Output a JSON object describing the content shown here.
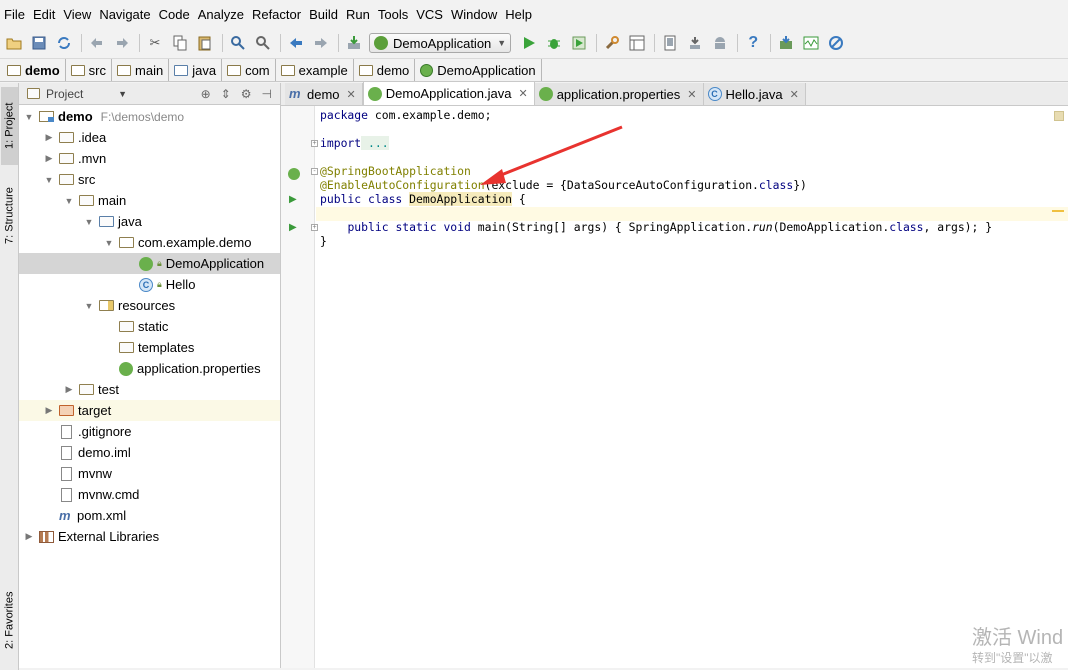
{
  "menu": [
    "File",
    "Edit",
    "View",
    "Navigate",
    "Code",
    "Analyze",
    "Refactor",
    "Build",
    "Run",
    "Tools",
    "VCS",
    "Window",
    "Help"
  ],
  "toolbar": {
    "run_config": "DemoApplication"
  },
  "breadcrumb": [
    "demo",
    "src",
    "main",
    "java",
    "com",
    "example",
    "demo",
    "DemoApplication"
  ],
  "left_strip": {
    "project": "1: Project",
    "structure": "7: Structure",
    "favorites": "2: Favorites"
  },
  "project_panel": {
    "view_selector": "Project",
    "root_name": "demo",
    "root_path": "F:\\demos\\demo",
    "tree": {
      "idea": ".idea",
      "mvn": ".mvn",
      "src": "src",
      "main": "main",
      "java": "java",
      "package": "com.example.demo",
      "demo_app": "DemoApplication",
      "hello": "Hello",
      "resources": "resources",
      "static": "static",
      "templates": "templates",
      "app_props": "application.properties",
      "test": "test",
      "target": "target",
      "gitignore": ".gitignore",
      "demo_iml": "demo.iml",
      "mvnw": "mvnw",
      "mvnw_cmd": "mvnw.cmd",
      "pom": "pom.xml",
      "ext_libs": "External Libraries"
    }
  },
  "tabs": [
    {
      "label": "demo",
      "icon": "maven"
    },
    {
      "label": "DemoApplication.java",
      "icon": "spring-class",
      "active": true
    },
    {
      "label": "application.properties",
      "icon": "spring-leaf"
    },
    {
      "label": "Hello.java",
      "icon": "class"
    }
  ],
  "code": {
    "l1_kw": "package",
    "l1_rest": " com.example.demo;",
    "l2_kw": "import",
    "l2_rest": " ...",
    "l3": "@SpringBootApplication",
    "l4_ann": "@EnableAutoConfiguration",
    "l4_a": "(exclude = {DataSourceAutoConfiguration.",
    "l4_kw": "class",
    "l4_b": "})",
    "l5_kw": "public class",
    "l5_name": "DemoApplication",
    "l5_rest": " {",
    "l7_kw1": "public static void",
    "l7_a": " main(String[] args) { SpringApplication.",
    "l7_run": "run",
    "l7_b": "(DemoApplication.",
    "l7_kw2": "class",
    "l7_c": ", args); }",
    "l8": "}"
  },
  "watermark": {
    "line1": "激活 Wind",
    "line2": "转到\"设置\"以激"
  },
  "colors": {
    "keyword": "#000080",
    "annotation": "#808000",
    "arrow": "#e8332f"
  }
}
